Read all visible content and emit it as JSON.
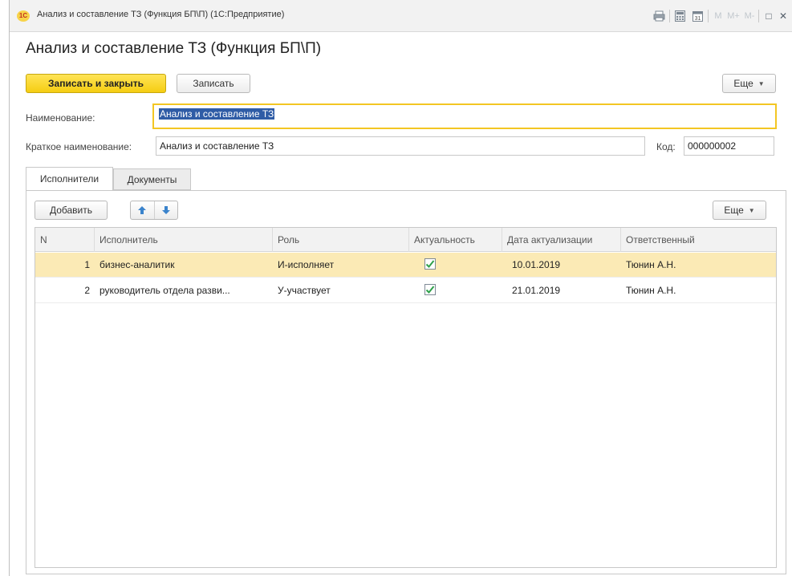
{
  "window": {
    "logo_text": "1С",
    "title": "Анализ и составление ТЗ (Функция БП\\П)  (1С:Предприятие)",
    "toolbar": {
      "m": "M",
      "m_plus": "M+",
      "m_minus": "M-",
      "restore": "□",
      "close": "✕"
    }
  },
  "form": {
    "title": "Анализ и составление ТЗ (Функция БП\\П)",
    "buttons": {
      "save_close": "Записать и закрыть",
      "save": "Записать",
      "more": "Еще"
    },
    "name_label": "Наименование:",
    "name_value": "Анализ и составление ТЗ",
    "short_name_label": "Краткое наименование:",
    "short_name_value": "Анализ и составление ТЗ",
    "code_label": "Код:",
    "code_value": "000000002"
  },
  "tabs": [
    {
      "label": "Исполнители",
      "active": true
    },
    {
      "label": "Документы",
      "active": false
    }
  ],
  "table_toolbar": {
    "add": "Добавить",
    "up_icon": "arrow-up-icon",
    "down_icon": "arrow-down-icon",
    "more": "Еще"
  },
  "table": {
    "columns": [
      "N",
      "Исполнитель",
      "Роль",
      "Актуальность",
      "Дата актуализации",
      "Ответственный"
    ],
    "rows": [
      {
        "n": "1",
        "executor": "бизнес-аналитик",
        "role": "И-исполняет",
        "actual": true,
        "date": "10.01.2019",
        "responsible": "Тюнин А.Н."
      },
      {
        "n": "2",
        "executor": "руководитель отдела разви...",
        "role": "У-участвует",
        "actual": true,
        "date": "21.01.2019",
        "responsible": "Тюнин А.Н."
      }
    ]
  },
  "colors": {
    "accent_yellow": "#f5cd12",
    "selected_row": "#fbeab5",
    "check_green": "#2ea04a",
    "arrow_blue": "#3a83cc"
  }
}
